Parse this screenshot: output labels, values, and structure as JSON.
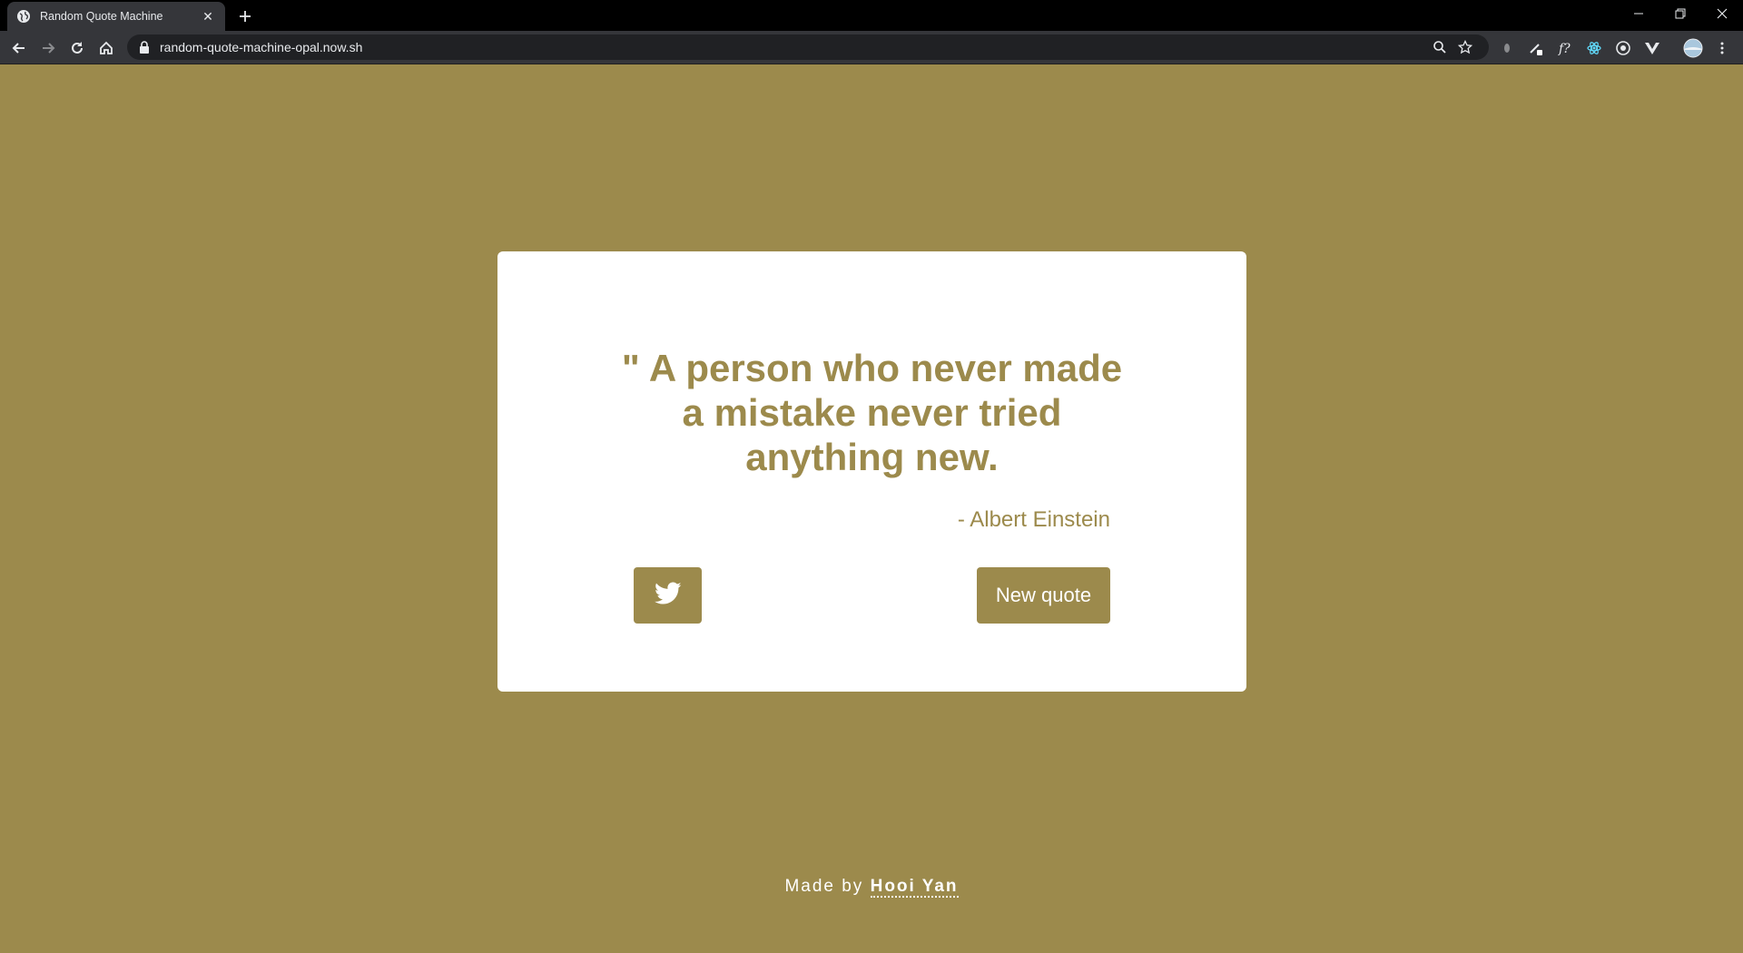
{
  "browser": {
    "tab_title": "Random Quote Machine",
    "url": "random-quote-machine-opal.now.sh"
  },
  "quote": {
    "text": "\" A person who never made a mistake never tried anything new.",
    "author": "- Albert Einstein"
  },
  "buttons": {
    "new_quote_label": "New quote"
  },
  "footer": {
    "prefix": "Made by",
    "author_link": "Hooi Yan"
  },
  "colors": {
    "accent": "#9c8a4c",
    "card": "#ffffff",
    "chrome_dark": "#35363a"
  }
}
